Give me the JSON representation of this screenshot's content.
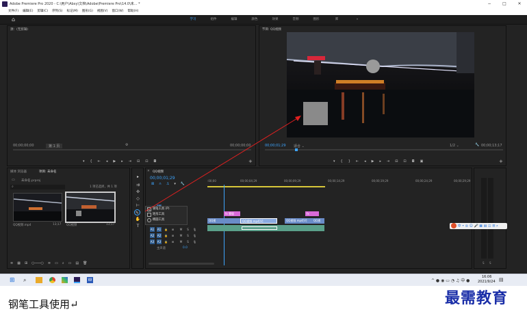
{
  "window": {
    "title": "Adobe Premiere Pro 2020 - C:\\用户\\Abxy\\文档\\Adobe\\Premiere Pro\\14.0\\未... *",
    "min": "−",
    "max": "□",
    "close": "✕"
  },
  "menu": [
    "文件(F)",
    "编辑(E)",
    "剪辑(C)",
    "序列(S)",
    "标记(M)",
    "图形(G)",
    "视图(V)",
    "窗口(W)",
    "帮助(H)"
  ],
  "workspaces": {
    "items": [
      "学习",
      "组件",
      "编辑",
      "颜色",
      "效果",
      "音频",
      "图形",
      "库"
    ],
    "more": "»",
    "active": 0
  },
  "source": {
    "title": "源：(无剪辑)",
    "tc_left": "00;00;00;00",
    "tc_right": "00;00;00;00",
    "page": "第 1 页"
  },
  "program": {
    "title": "节目: QQ视频",
    "tc_current": "00;00;01;29",
    "fit": "适合",
    "zoom": "1/2",
    "tc_total": "00;00;13;17"
  },
  "project": {
    "tabs": [
      "媒体 浏览器",
      "项目: 未命名"
    ],
    "file": "未命名.prproj",
    "search_placeholder": "",
    "count": "1 项已选择，共 1 项",
    "items": [
      {
        "name": "QQ视频.mp4",
        "dur": "13;17"
      },
      {
        "name": "QQ视频",
        "dur": "13;17"
      }
    ]
  },
  "timeline": {
    "title": "QQ视频",
    "tc": "00;00;01;29",
    "ruler": [
      ":00;00",
      "00;00;04;29",
      "00;00;09;29",
      "00;00;14;29",
      "00;00;19;29",
      "00;00;24;29",
      "00;00;29;29",
      "00;00;"
    ],
    "tracks": {
      "video": [
        "V3",
        "V2",
        "V1"
      ],
      "audio": [
        "A1",
        "A2",
        "A3"
      ],
      "master": "主声道",
      "master_val": "0.0"
    },
    "clips": {
      "fx1": "fx",
      "fx2": "fx",
      "labels": [
        "QQ视",
        "QQ视频.mp4[V]",
        "QQ视频.mp4[V]",
        "QQ视"
      ],
      "top_label": "蒙版"
    }
  },
  "context_menu": {
    "items": [
      "钢笔工具 (P)",
      "矩形工具",
      "椭圆工具"
    ]
  },
  "audio_meter": {
    "labels": [
      "S",
      "S"
    ]
  },
  "taskbar": {
    "time": "16:06",
    "date": "2021/9/24",
    "apps": [
      "win",
      "search",
      "files",
      "chrome",
      "colors",
      "premiere",
      "word"
    ]
  },
  "caption": "钢笔工具使用↵",
  "watermark": "最需教育"
}
